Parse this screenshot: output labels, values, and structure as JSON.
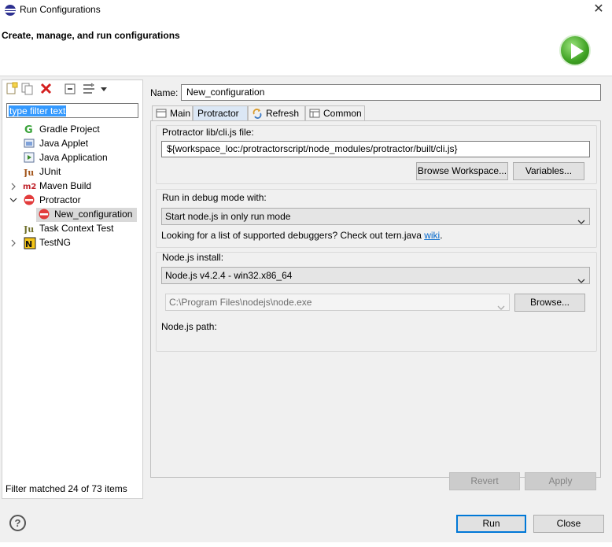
{
  "window": {
    "title": "Run Configurations",
    "close_glyph": "✕"
  },
  "header": {
    "title": "Create, manage, and run configurations",
    "icon": "run-icon"
  },
  "left": {
    "toolbar": [
      {
        "name": "new-config-icon"
      },
      {
        "name": "duplicate-icon"
      },
      {
        "name": "delete-icon"
      },
      {
        "name": "collapse-all-icon"
      },
      {
        "name": "filter-icon"
      },
      {
        "name": "view-menu-icon"
      }
    ],
    "filter_value": "type filter text",
    "tree": [
      {
        "label": "Gradle Project",
        "icon": "gradle-icon"
      },
      {
        "label": "Java Applet",
        "icon": "java-applet-icon"
      },
      {
        "label": "Java Application",
        "icon": "java-app-icon"
      },
      {
        "label": "JUnit",
        "icon": "junit-icon"
      },
      {
        "label": "Maven Build",
        "icon": "maven-icon"
      },
      {
        "label": "Protractor",
        "icon": "protractor-icon"
      },
      {
        "label": "New_configuration",
        "icon": "protractor-icon"
      },
      {
        "label": "Task Context Test",
        "icon": "task-context-icon"
      },
      {
        "label": "TestNG",
        "icon": "testng-icon"
      }
    ],
    "status": "Filter matched 24 of 73 items"
  },
  "right": {
    "name_label": "Name:",
    "name_value": "New_configuration",
    "tabs": [
      {
        "label": "Main"
      },
      {
        "label": "Protractor"
      },
      {
        "label": "Refresh"
      },
      {
        "label": "Common"
      }
    ],
    "cli": {
      "label": "Protractor lib/cli.js file:",
      "value": "${workspace_loc:/protractorscript/node_modules/protractor/built/cli.js}",
      "browse": "Browse Workspace...",
      "variables": "Variables..."
    },
    "debug": {
      "label": "Run in debug mode with:",
      "selected": "Start node.js in only run mode",
      "help_text": "Looking for a list of supported debuggers? Check out tern.java",
      "link": "wiki",
      "period": "."
    },
    "node": {
      "label": "Node.js install:",
      "selected": "Node.js v4.2.4 - win32.x86_64",
      "path_value": "C:\\Program Files\\nodejs\\node.exe",
      "browse": "Browse...",
      "path_label": "Node.js path:"
    },
    "revert": "Revert",
    "apply": "Apply"
  },
  "footer": {
    "run": "Run",
    "close": "Close",
    "help_glyph": "?"
  }
}
